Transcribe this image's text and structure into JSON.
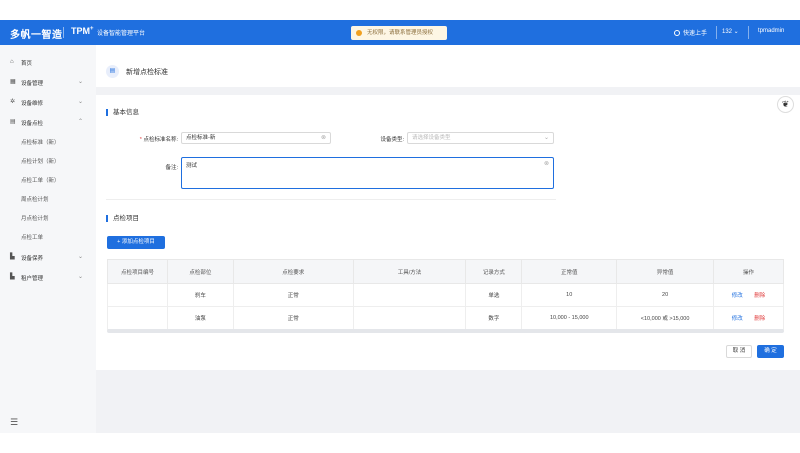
{
  "header": {
    "brand": "多帆一智造",
    "product": "TPM",
    "product_sup": "+",
    "platform": "设备智能管理平台",
    "notice": "无权限，请联系管理员授权",
    "quick_start": "快速上手",
    "version": "132",
    "user": "tpmadmin"
  },
  "sidebar": {
    "items": [
      {
        "label": "首页",
        "icon": "home-icon"
      },
      {
        "label": "设备管理",
        "icon": "device-icon",
        "chevron": "⌄"
      },
      {
        "label": "设备维修",
        "icon": "repair-icon",
        "chevron": "⌄"
      },
      {
        "label": "设备点检",
        "icon": "inspect-icon",
        "chevron": "⌃"
      },
      {
        "label": "设备保养",
        "icon": "maintain-icon",
        "chevron": "⌄"
      },
      {
        "label": "租户管理",
        "icon": "tenant-icon",
        "chevron": "⌄"
      }
    ],
    "sub_items": [
      "点检标准（新）",
      "点检计划（新）",
      "点检工单（新）",
      "周点检计划",
      "月点检计划",
      "点检工单"
    ]
  },
  "page": {
    "title": "新增点检标准",
    "section_basic": "基本信息",
    "section_items": "点检项目",
    "form": {
      "name_label": "点检标准名称:",
      "name_value": "点检标准-新",
      "type_label": "设备类型:",
      "type_placeholder": "请选择设备类型",
      "remark_label": "备注:",
      "remark_value": "测试"
    },
    "add_button": "+ 添加点检项目",
    "cancel": "取 消",
    "confirm": "确 定"
  },
  "table": {
    "columns": [
      "点检项目编号",
      "点检部位",
      "点检要求",
      "工具/方法",
      "记录方式",
      "正常值",
      "异常值",
      "操作"
    ],
    "rows": [
      [
        "",
        "刹车",
        "正常",
        "",
        "单选",
        "10",
        "20"
      ],
      [
        "",
        "油泵",
        "正常",
        "",
        "数字",
        "10,000 - 15,000",
        "<10,000 或 >15,000"
      ]
    ],
    "edit": "修改",
    "delete": "删除"
  },
  "colors": {
    "primary": "#1f6fdf",
    "danger": "#e03b3b"
  }
}
